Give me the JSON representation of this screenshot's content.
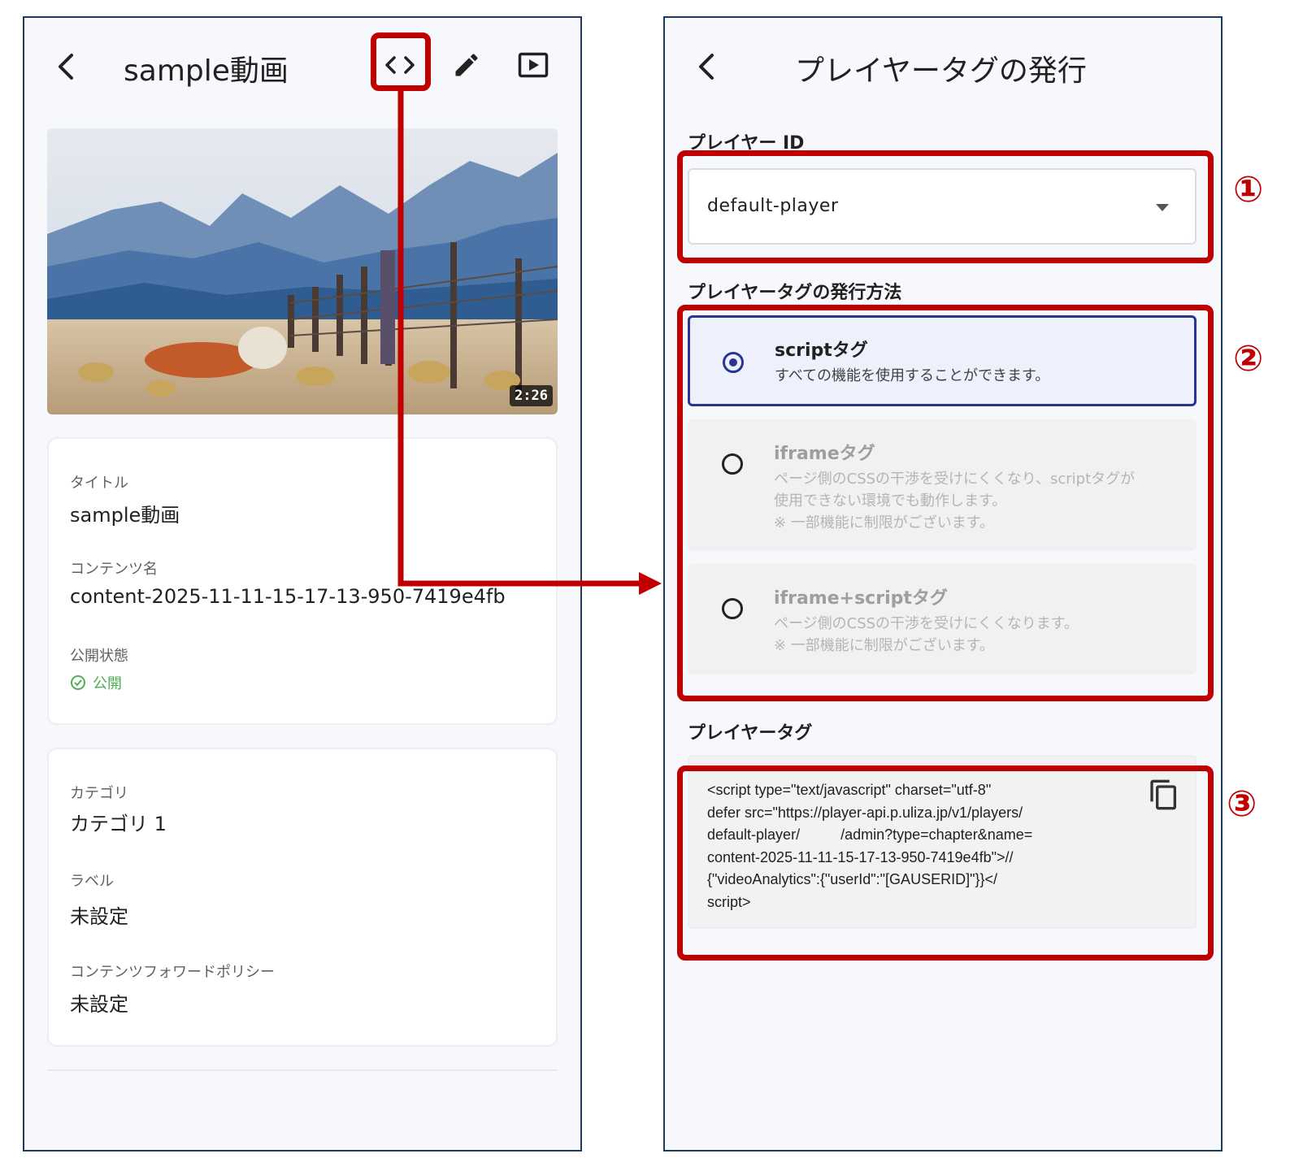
{
  "left": {
    "header": {
      "title": "sample動画"
    },
    "thumbnail": {
      "duration": "2:26"
    },
    "info": {
      "title_label": "タイトル",
      "title_value": "sample動画",
      "content_name_label": "コンテンツ名",
      "content_name_value": "content-2025-11-11-15-17-13-950-7419e4fb",
      "status_label": "公開状態",
      "status_value": "公開"
    },
    "meta": {
      "category_label": "カテゴリ",
      "category_value": "カテゴリ 1",
      "label_label": "ラベル",
      "label_value": "未設定",
      "policy_label": "コンテンツフォワードポリシー",
      "policy_value": "未設定"
    }
  },
  "right": {
    "header": {
      "title": "プレイヤータグの発行"
    },
    "player_id": {
      "label": "プレイヤー ID",
      "value": "default-player"
    },
    "method": {
      "label": "プレイヤータグの発行方法",
      "options": [
        {
          "title": "scriptタグ",
          "desc": [
            "すべての機能を使用することができます。"
          ],
          "selected": true
        },
        {
          "title": "iframeタグ",
          "desc": [
            "ページ側のCSSの干渉を受けにくくなり、scriptタグが",
            "使用できない環境でも動作します。",
            "※ 一部機能に制限がございます。"
          ],
          "selected": false
        },
        {
          "title": "iframe+scriptタグ",
          "desc": [
            "ページ側のCSSの干渉を受けにくくなります。",
            "※ 一部機能に制限がございます。"
          ],
          "selected": false
        }
      ]
    },
    "player_tag": {
      "label": "プレイヤータグ",
      "lines": [
        "<script type=\"text/javascript\" charset=\"utf-8\"",
        "defer src=\"https://player-api.p.uliza.jp/v1/players/",
        "default-player/          /admin?type=chapter&name=",
        "content-2025-11-11-15-17-13-950-7419e4fb\">//",
        "{\"videoAnalytics\":{\"userId\":\"[GAUSERID]\"}}</",
        "script>"
      ]
    }
  },
  "annotations": {
    "n1": "①",
    "n2": "②",
    "n3": "③"
  },
  "colors": {
    "highlight": "#c00000",
    "primary": "#283593",
    "success": "#4caf50"
  }
}
